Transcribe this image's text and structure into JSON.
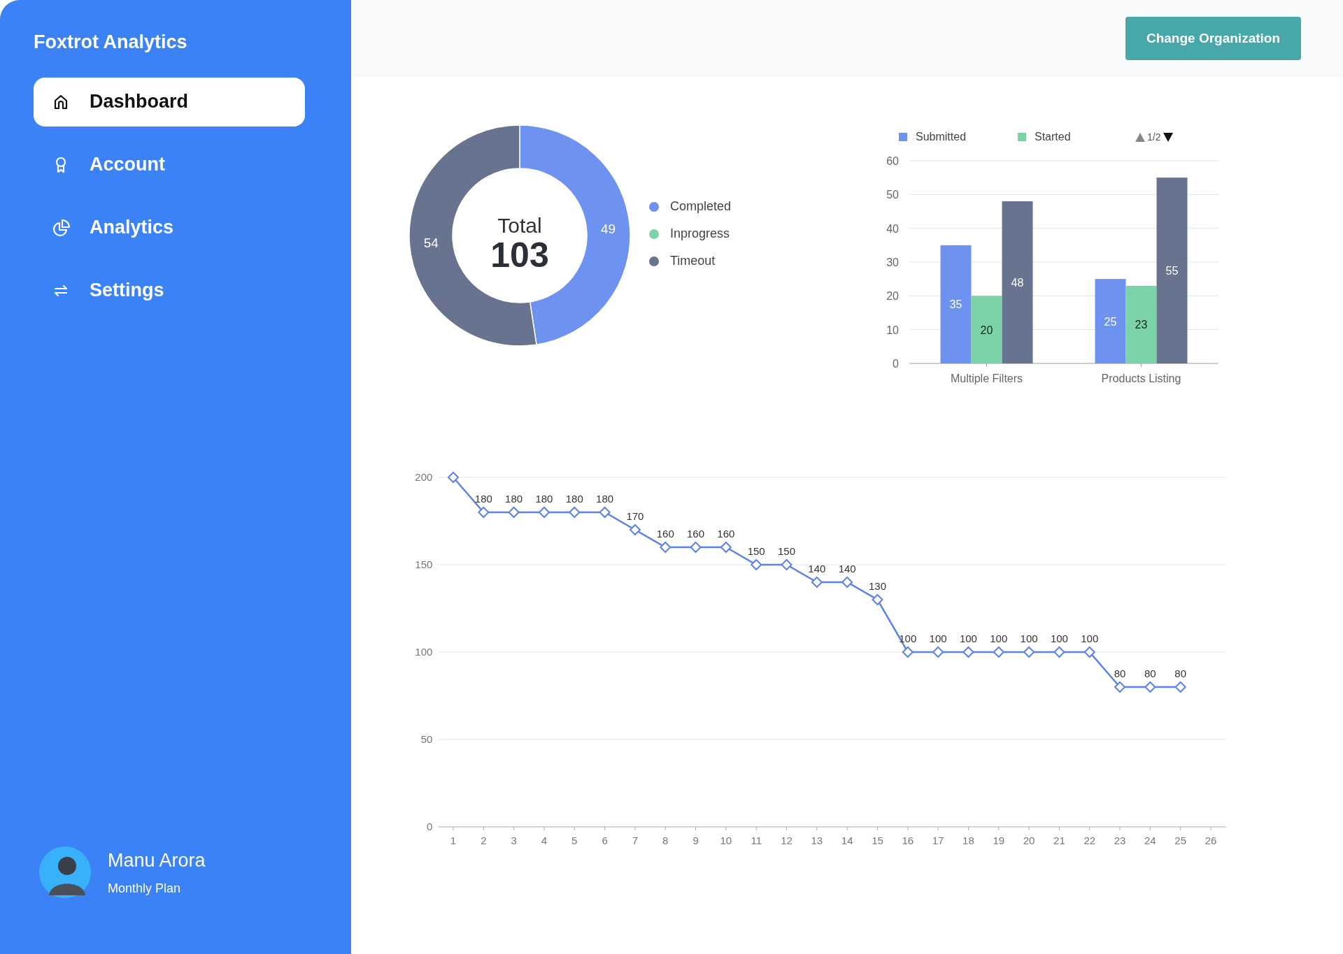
{
  "sidebar": {
    "brand": "Foxtrot Analytics",
    "items": [
      {
        "label": "Dashboard",
        "selected": true
      },
      {
        "label": "Account",
        "selected": false
      },
      {
        "label": "Analytics",
        "selected": false
      },
      {
        "label": "Settings",
        "selected": false
      }
    ],
    "user": {
      "name": "Manu Arora",
      "plan": "Monthly Plan"
    }
  },
  "header": {
    "button": "Change Organization"
  },
  "status_donut": {
    "center_label": "Total",
    "center_value": "103",
    "chart_data": {
      "type": "donut",
      "categories": [
        "Completed",
        "Inprogress",
        "Timeout"
      ],
      "values": [
        49,
        0,
        54
      ],
      "data_labels": true
    }
  },
  "task_bars": {
    "legend_page": "1/2",
    "chart_data": {
      "type": "bar",
      "categories": [
        "Multiple Filters",
        "Products Listing"
      ],
      "series": [
        {
          "name": "Submitted",
          "color": "#6e92ef",
          "values": [
            35,
            25
          ]
        },
        {
          "name": "Started",
          "color": "#7dd3a8",
          "values": [
            20,
            23
          ]
        },
        {
          "color": "#67738f",
          "values": [
            48,
            55
          ]
        }
      ],
      "ylim": [
        0,
        60
      ],
      "yticks": [
        0,
        10,
        20,
        30,
        40,
        50,
        60
      ],
      "grid": true,
      "legend": "top",
      "value_labels": [
        [
          "35",
          "25"
        ],
        [
          "20",
          "23"
        ],
        [
          "48",
          "55"
        ]
      ]
    }
  },
  "trend_line": {
    "chart_data": {
      "type": "line",
      "x": [
        1,
        2,
        3,
        4,
        5,
        6,
        7,
        8,
        9,
        10,
        11,
        12,
        13,
        14,
        15,
        16,
        17,
        18,
        19,
        20,
        21,
        22,
        23,
        24,
        25
      ],
      "series": [
        {
          "color": "#5b82ea",
          "marker": "diamond",
          "values": [
            200,
            180,
            180,
            180,
            180,
            180,
            170,
            160,
            160,
            160,
            150,
            150,
            140,
            140,
            130,
            100,
            100,
            100,
            100,
            100,
            100,
            100,
            80,
            80,
            80
          ]
        }
      ],
      "value_labels": [
        null,
        "180",
        "180",
        "180",
        "180",
        "180",
        "170",
        "160",
        "160",
        "160",
        "150",
        "150",
        "140",
        "140",
        "130",
        "100",
        "100",
        "100",
        "100",
        "100",
        "100",
        "100",
        "80",
        "80",
        "80"
      ],
      "xlim": [
        0.5,
        26.5
      ],
      "grid": true,
      "xticks": [
        1,
        2,
        3,
        4,
        5,
        6,
        7,
        8,
        9,
        10,
        11,
        12,
        13,
        14,
        15,
        16,
        17,
        18,
        19,
        20,
        21,
        22,
        23,
        24,
        25,
        26
      ],
      "ylim": [
        0,
        200
      ],
      "yticks": [
        0,
        50,
        100,
        150,
        200
      ]
    }
  }
}
